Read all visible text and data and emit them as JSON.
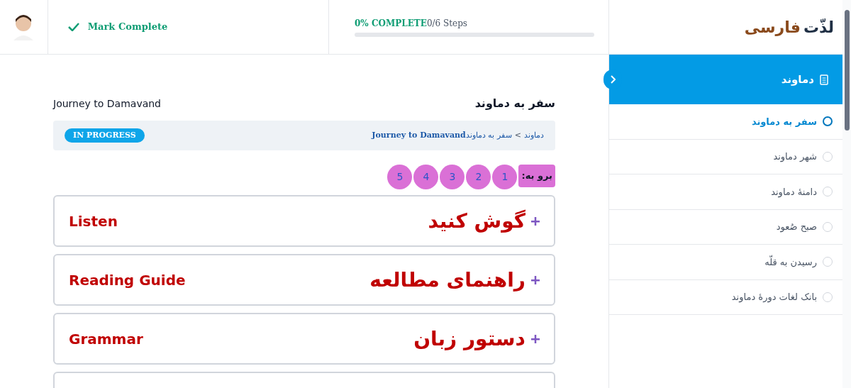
{
  "header": {
    "mark_complete": "Mark Complete",
    "progress_label": "0% COMPLETE",
    "steps": "0/6 Steps",
    "level": 0,
    "logo": {
      "part1": "لذّت",
      "part2": "فارسی"
    }
  },
  "lesson": {
    "title_fa": "سفر به دماوند",
    "title_en": "Journey to Damavand",
    "status": "IN PROGRESS",
    "breadcrumb": [
      "دماوند",
      "سفر به دماوند"
    ],
    "separator": ">",
    "breadcrumb_tail": "Journey to Damavand"
  },
  "pagination": {
    "label": "برو به:",
    "pages": [
      "1",
      "2",
      "3",
      "4",
      "5"
    ]
  },
  "sections": [
    {
      "fa": "گوش کنید",
      "en": "Listen",
      "expanded": false
    },
    {
      "fa": "راهنمای مطالعه",
      "en": "Reading Guide",
      "expanded": false
    },
    {
      "fa": "دستور زبان",
      "en": "Grammar",
      "expanded": false
    }
  ],
  "sidebar": {
    "title": "دماوند",
    "items": [
      {
        "label": "سفر به دماوند",
        "selected": true
      },
      {
        "label": "شهر دماوند",
        "selected": false
      },
      {
        "label": "دامنهٔ دماوند",
        "selected": false
      },
      {
        "label": "صبح صُعود",
        "selected": false
      },
      {
        "label": "رسیدن به قلّه",
        "selected": false
      },
      {
        "label": "بانک لغات دورهٔ دماوند",
        "selected": false
      }
    ]
  }
}
